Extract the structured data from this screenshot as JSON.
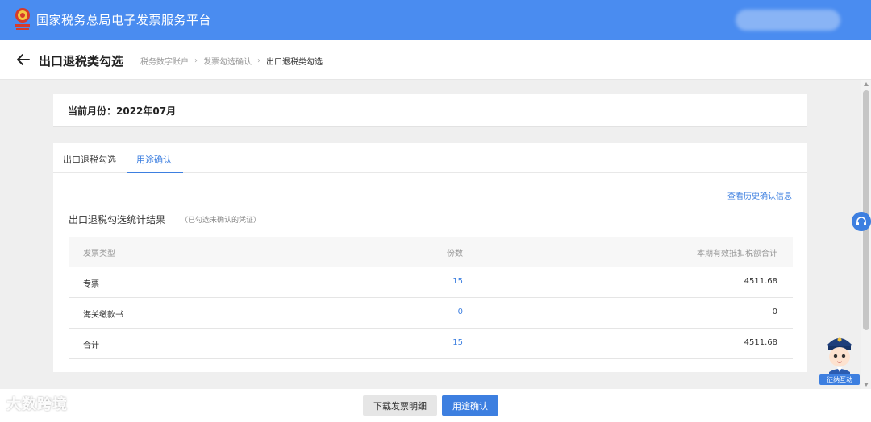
{
  "header": {
    "app_title": "国家税务总局电子发票服务平台",
    "brand_color": "#4a8cf0"
  },
  "page": {
    "title": "出口退税类勾选",
    "breadcrumb": [
      "税务数字账户",
      "发票勾选确认",
      "出口退税类勾选"
    ]
  },
  "month": {
    "label": "当前月份：2022年07月"
  },
  "tabs": [
    {
      "label": "出口退税勾选",
      "active": false
    },
    {
      "label": "用途确认",
      "active": true
    }
  ],
  "section": {
    "history_link": "查看历史确认信息",
    "title": "出口退税勾选统计结果",
    "note": "（已勾选未确认的凭证）"
  },
  "table": {
    "headers": [
      "发票类型",
      "份数",
      "本期有效抵扣税额合计"
    ],
    "rows": [
      {
        "type": "专票",
        "count": "15",
        "amount": "4511.68"
      },
      {
        "type": "海关缴款书",
        "count": "0",
        "amount": "0"
      },
      {
        "type": "合计",
        "count": "15",
        "amount": "4511.68"
      }
    ]
  },
  "actions": {
    "download_label": "下载发票明细",
    "confirm_label": "用途确认"
  },
  "assistant": {
    "label": "征纳互动"
  },
  "watermark": "大数跨境",
  "icons": [
    "tax-emblem-icon",
    "back-arrow-icon",
    "headset-icon",
    "assistant-avatar-icon"
  ],
  "colors": {
    "accent": "#3d7fe0",
    "header": "#4a8cf0",
    "emblem_red": "#d63a2a"
  }
}
